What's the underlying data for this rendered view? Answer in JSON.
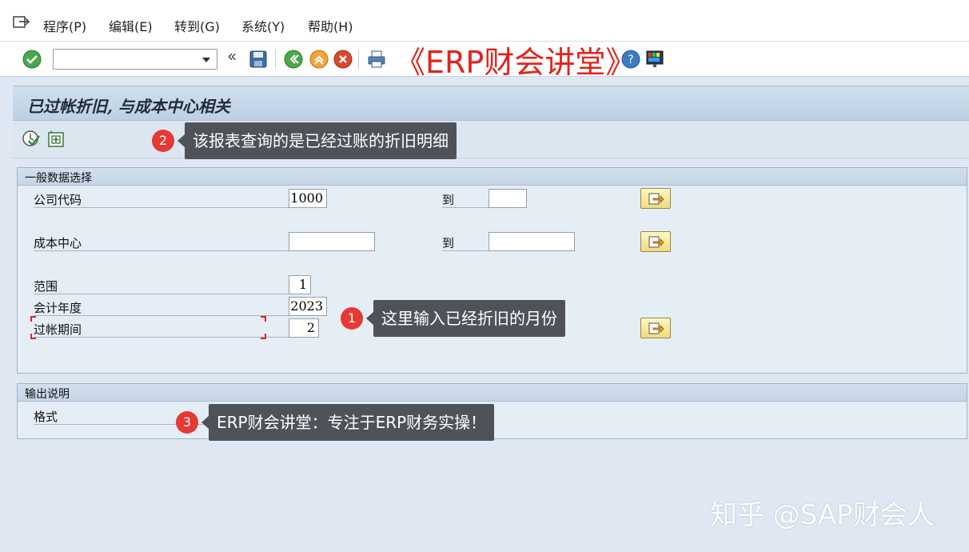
{
  "menu": {
    "items": [
      "程序(P)",
      "编辑(E)",
      "转到(G)",
      "系统(Y)",
      "帮助(H)"
    ]
  },
  "toolbar": {
    "command_value": "",
    "watermark": "《ERP财会讲堂》"
  },
  "screen": {
    "title": "已过帐折旧, 与成本中心相关"
  },
  "general_selection": {
    "header": "一般数据选择",
    "company_code_label": "公司代码",
    "company_code_value": "1000",
    "company_code_to_label": "到",
    "company_code_to_value": "",
    "cost_center_label": "成本中心",
    "cost_center_value": "",
    "cost_center_to_label": "到",
    "cost_center_to_value": "",
    "area_label": "范围",
    "area_value": "1",
    "fiscal_year_label": "会计年度",
    "fiscal_year_value": "2023",
    "posting_period_label": "过帐期间",
    "posting_period_value": "2"
  },
  "output": {
    "header": "输出说明",
    "layout_label": "格式",
    "layout_value": ""
  },
  "callouts": {
    "c1_num": "1",
    "c1_text": "这里输入已经折旧的月份",
    "c2_num": "2",
    "c2_text": "该报表查询的是已经过账的折旧明细",
    "c3_num": "3",
    "c3_text": "ERP财会讲堂：专注于ERP财务实操！"
  },
  "watermark_corner": "知乎 @SAP财会人",
  "colors": {
    "accent_red": "#e2231a",
    "callout_bg": "#4f5359",
    "badge_red": "#e53935",
    "page_bg": "#dfe8f2"
  }
}
